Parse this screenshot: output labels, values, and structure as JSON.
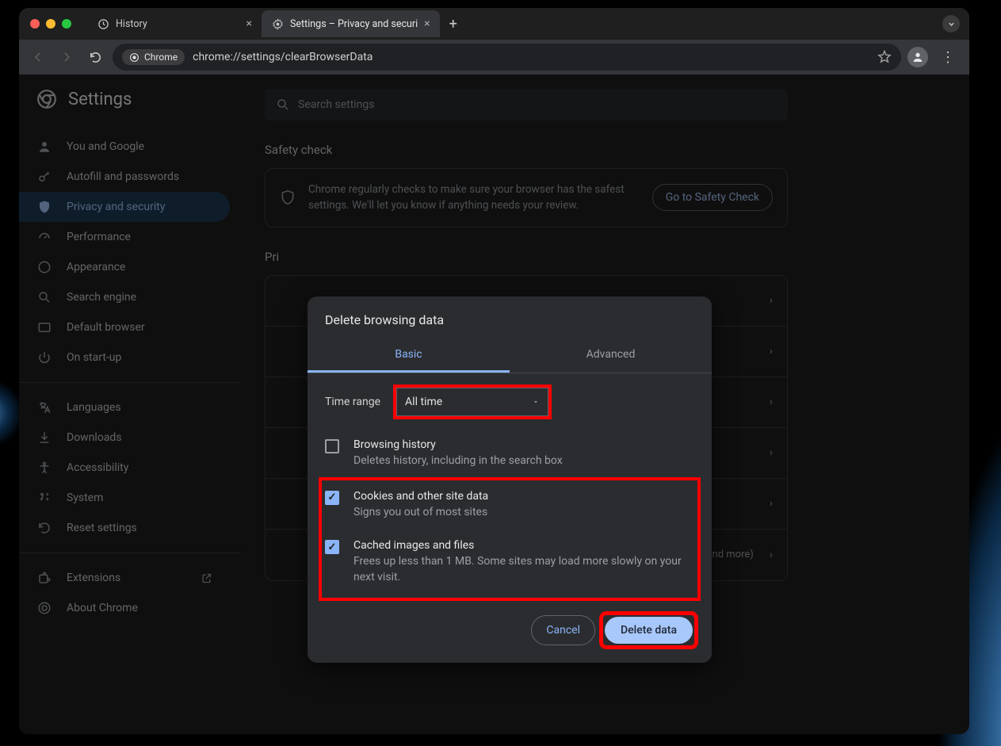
{
  "window": {
    "tabs": [
      {
        "title": "History",
        "icon": "history"
      },
      {
        "title": "Settings – Privacy and securi",
        "icon": "gear",
        "active": true
      }
    ]
  },
  "toolbar": {
    "addr_chip": "Chrome",
    "url": "chrome://settings/clearBrowserData"
  },
  "page": {
    "title": "Settings",
    "search_placeholder": "Search settings"
  },
  "sidebar": {
    "items": [
      {
        "label": "You and Google",
        "icon": "person"
      },
      {
        "label": "Autofill and passwords",
        "icon": "key"
      },
      {
        "label": "Privacy and security",
        "icon": "shield",
        "active": true
      },
      {
        "label": "Performance",
        "icon": "speed"
      },
      {
        "label": "Appearance",
        "icon": "palette"
      },
      {
        "label": "Search engine",
        "icon": "search"
      },
      {
        "label": "Default browser",
        "icon": "browser"
      },
      {
        "label": "On start-up",
        "icon": "power"
      }
    ],
    "items2": [
      {
        "label": "Languages",
        "icon": "lang"
      },
      {
        "label": "Downloads",
        "icon": "download"
      },
      {
        "label": "Accessibility",
        "icon": "a11y"
      },
      {
        "label": "System",
        "icon": "system"
      },
      {
        "label": "Reset settings",
        "icon": "reset"
      }
    ],
    "items3": [
      {
        "label": "Extensions",
        "icon": "ext",
        "external": true
      },
      {
        "label": "About Chrome",
        "icon": "about"
      }
    ]
  },
  "safety": {
    "section": "Safety check",
    "text": "Chrome regularly checks to make sure your browser has the safest settings. We'll let you know if anything needs your review.",
    "button": "Go to Safety Check"
  },
  "privacy": {
    "section_partial": "Pri",
    "row_tail": "and more)"
  },
  "dialog": {
    "title": "Delete browsing data",
    "tabs": {
      "basic": "Basic",
      "advanced": "Advanced"
    },
    "time_label": "Time range",
    "time_value": "All time",
    "items": [
      {
        "title": "Browsing history",
        "sub": "Deletes history, including in the search box",
        "checked": false
      },
      {
        "title": "Cookies and other site data",
        "sub": "Signs you out of most sites",
        "checked": true
      },
      {
        "title": "Cached images and files",
        "sub": "Frees up less than 1 MB. Some sites may load more slowly on your next visit.",
        "checked": true
      }
    ],
    "cancel": "Cancel",
    "confirm": "Delete data"
  }
}
